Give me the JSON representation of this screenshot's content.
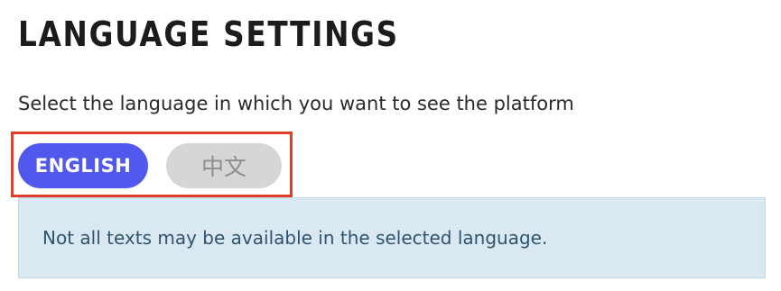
{
  "page": {
    "title": "LANGUAGE SETTINGS",
    "description": "Select the language in which you want to see the platform"
  },
  "languages": [
    {
      "label": "ENGLISH",
      "selected": true
    },
    {
      "label": "中文",
      "selected": false
    }
  ],
  "notice": {
    "text": "Not all texts may be available in the selected language."
  },
  "colors": {
    "accent": "#5158ee",
    "inactive_button": "#d6d6d6",
    "notice_background": "#d9e8f1",
    "highlight_border": "#de3f2a"
  }
}
